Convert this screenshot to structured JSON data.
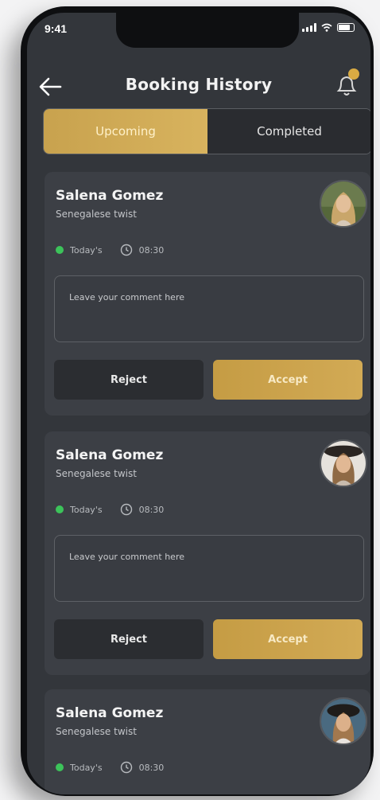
{
  "status_bar": {
    "time": "9:41"
  },
  "header": {
    "title": "Booking History"
  },
  "tabs": [
    {
      "label": "Upcoming",
      "active": true
    },
    {
      "label": "Completed",
      "active": false
    }
  ],
  "bookings": [
    {
      "name": "Salena Gomez",
      "service": "Senegalese twist",
      "day": "Today's",
      "time": "08:30",
      "comment_placeholder": "Leave your comment here",
      "reject_label": "Reject",
      "accept_label": "Accept"
    },
    {
      "name": "Salena Gomez",
      "service": "Senegalese twist",
      "day": "Today's",
      "time": "08:30",
      "comment_placeholder": "Leave your comment here",
      "reject_label": "Reject",
      "accept_label": "Accept"
    },
    {
      "name": "Salena Gomez",
      "service": "Senegalese twist",
      "day": "Today's",
      "time": "08:30"
    }
  ],
  "colors": {
    "accent_gold": "#d2aa55",
    "status_green": "#3cc35a",
    "card_bg": "#3c3f45",
    "screen_bg": "#33363b"
  }
}
